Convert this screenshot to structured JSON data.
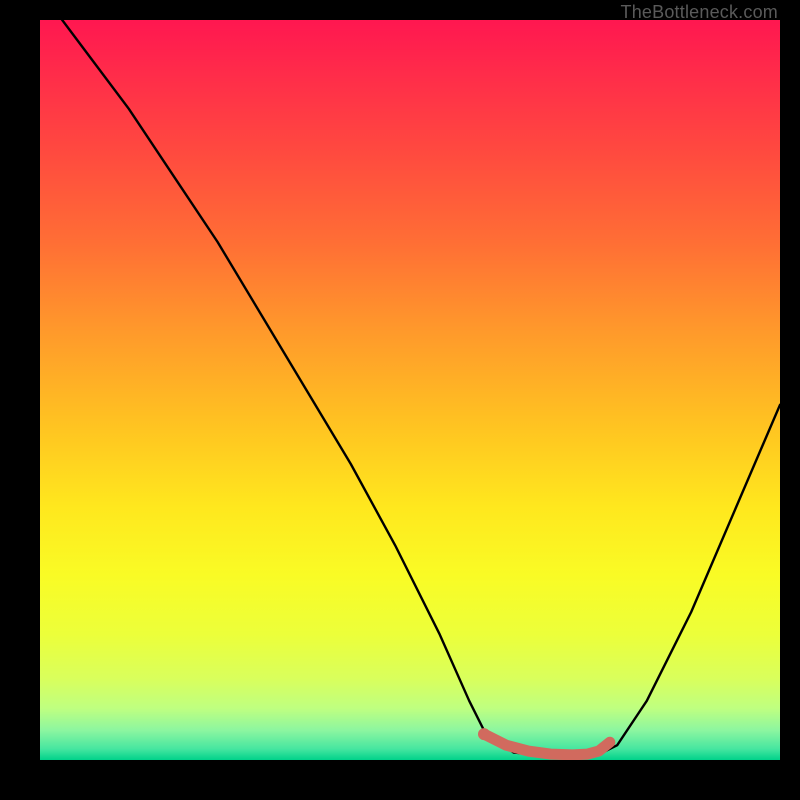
{
  "attribution": "TheBottleneck.com",
  "colors": {
    "black": "#000000",
    "curve": "#000000",
    "marker": "#d16a5e",
    "attribution_text": "#5a5a5a",
    "gradient_stops": [
      {
        "offset": 0.0,
        "color": "#ff1750"
      },
      {
        "offset": 0.07,
        "color": "#ff2b4a"
      },
      {
        "offset": 0.18,
        "color": "#ff4a3f"
      },
      {
        "offset": 0.3,
        "color": "#ff6e35"
      },
      {
        "offset": 0.42,
        "color": "#ff992b"
      },
      {
        "offset": 0.55,
        "color": "#ffc421"
      },
      {
        "offset": 0.66,
        "color": "#ffe81e"
      },
      {
        "offset": 0.75,
        "color": "#f9fb25"
      },
      {
        "offset": 0.83,
        "color": "#ecff3a"
      },
      {
        "offset": 0.89,
        "color": "#d9ff5c"
      },
      {
        "offset": 0.93,
        "color": "#bfff80"
      },
      {
        "offset": 0.96,
        "color": "#8cf6a0"
      },
      {
        "offset": 0.985,
        "color": "#46e6a0"
      },
      {
        "offset": 1.0,
        "color": "#00d28a"
      }
    ]
  },
  "chart_data": {
    "type": "line",
    "title": "",
    "xlabel": "",
    "ylabel": "",
    "xlim": [
      0,
      100
    ],
    "ylim": [
      0,
      100
    ],
    "grid": false,
    "legend": false,
    "series": [
      {
        "name": "bottleneck-curve",
        "x": [
          0,
          6,
          12,
          18,
          24,
          30,
          36,
          42,
          48,
          54,
          58,
          60,
          64,
          70,
          75,
          78,
          82,
          88,
          94,
          100
        ],
        "y": [
          104,
          96,
          88,
          79,
          70,
          60,
          50,
          40,
          29,
          17,
          8,
          4,
          1,
          0.5,
          0.5,
          2,
          8,
          20,
          34,
          48
        ]
      }
    ],
    "highlight": {
      "name": "optimal-range",
      "x": [
        60,
        63,
        66,
        69,
        72,
        74,
        75.5,
        77
      ],
      "y": [
        3.5,
        2.0,
        1.2,
        0.8,
        0.7,
        0.8,
        1.2,
        2.4
      ]
    },
    "marker": {
      "x": 60,
      "y": 3.5
    }
  }
}
